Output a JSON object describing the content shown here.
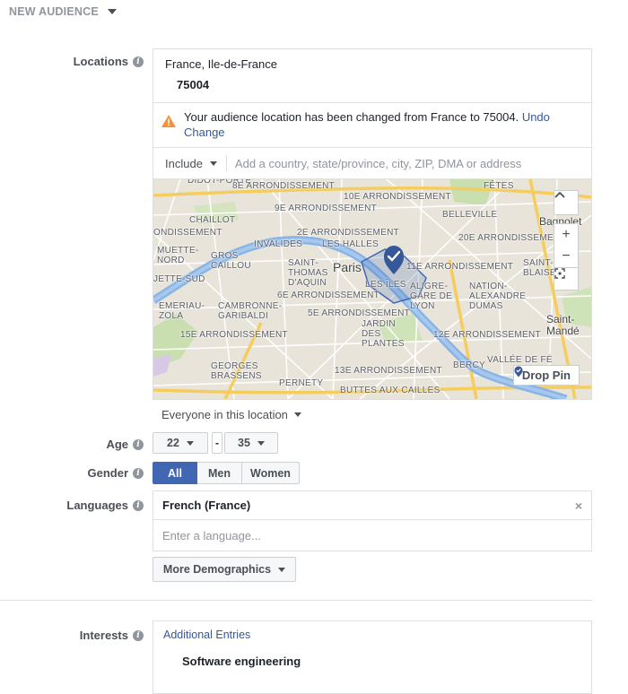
{
  "header": {
    "title": "NEW AUDIENCE"
  },
  "locations": {
    "label": "Locations",
    "region": "France, Ile-de-France",
    "postal": "75004",
    "warning_text": "Your audience location has been changed from France to 75004.",
    "undo_label": "Undo Change",
    "include_label": "Include",
    "search_placeholder": "Add a country, state/province, city, ZIP, DMA or address",
    "map_labels": [
      "8E ARRONDISSEMENT",
      "10E ARRONDISSEMENT",
      "FÊTES",
      "9E ARRONDISSEMENT",
      "BELLEVILLE",
      "CHAILLOT",
      "Bagnolet",
      "2E ARRONDISSEMENT",
      "20E ARRONDISSEMEN",
      "INVALIDES",
      "LES HALLES",
      "GROS CAILLOU",
      "SAINT- THOMAS D'AQUIN",
      "Paris",
      "11E ARRONDISSEMENT",
      "SAINT- BLAISE",
      "LES ÎLES",
      "ALIGRE- GARE DE LYON",
      "NATION- ALEXANDRE DUMAS",
      "6E ARRONDISSEMENT",
      "CAMBRONNE- GARIBALDI",
      "5E ARRONDISSEMENT",
      "JARDIN DES PLANTES",
      "12E ARRONDISSEMENT",
      "Saint- Mandé",
      "15E ARRONDISSEMENT",
      "GEORGES BRASSENS",
      "13E ARRONDISSEMENT",
      "BERCY",
      "VALLÉE DE FÉ",
      "PERNETY",
      "BUTTES AUX CAILLES",
      "DIDOT-PORTE",
      "ONDISSEMENT",
      "MUETTE- NORD",
      "JETTE-SUD",
      "EMERIAU- ZOLA",
      "CHAILLOT"
    ],
    "drop_pin_label": "Drop Pin",
    "zoom_in": "+",
    "zoom_out": "−",
    "scroll_up": "^",
    "everyone_label": "Everyone in this location"
  },
  "age": {
    "label": "Age",
    "min": "22",
    "max": "35",
    "dash": "-"
  },
  "gender": {
    "label": "Gender",
    "options": [
      "All",
      "Men",
      "Women"
    ],
    "selected": "All"
  },
  "languages": {
    "label": "Languages",
    "selected": "French (France)",
    "remove": "×",
    "placeholder": "Enter a language..."
  },
  "more_demographics": {
    "label": "More Demographics"
  },
  "interests": {
    "label": "Interests",
    "additional_entries": "Additional Entries",
    "entry": "Software engineering"
  },
  "colors": {
    "accent": "#4267b2",
    "link": "#365899",
    "warning": "#f7923b",
    "pin": "#365899"
  }
}
